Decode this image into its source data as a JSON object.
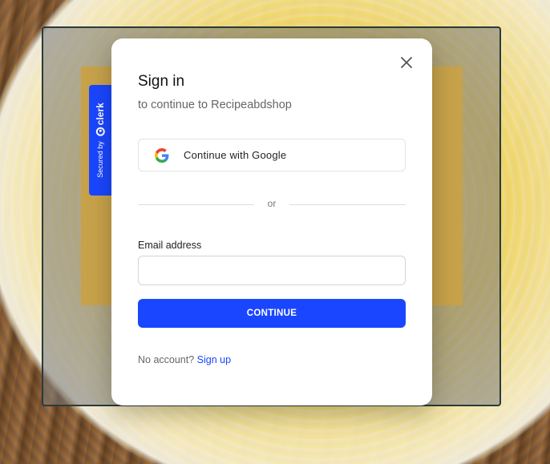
{
  "badge": {
    "secured_by": "Secured by",
    "brand": "clerk"
  },
  "modal": {
    "title": "Sign in",
    "subtitle": "to continue to Recipeabdshop",
    "google_button_label": "Continue with Google",
    "divider_text": "or",
    "email_label": "Email address",
    "email_value": "",
    "continue_label": "CONTINUE",
    "footer_text": "No account?",
    "signup_link": "Sign up"
  },
  "colors": {
    "accent": "#1a46ff",
    "card_back": "#c7a24a"
  },
  "icons": {
    "close": "close-icon",
    "google": "google-icon",
    "clerk": "clerk-logo-icon"
  }
}
